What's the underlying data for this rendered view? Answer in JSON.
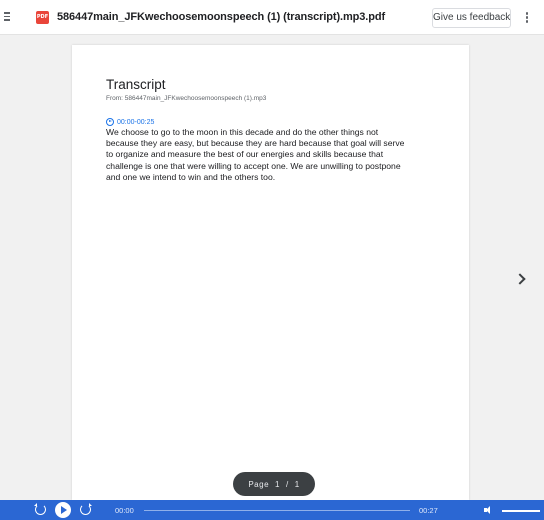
{
  "topbar": {
    "file_icon": "pdf-file-icon",
    "file_icon_label": "PDF",
    "file_name": "586447main_JFKwechoosemoonspeech (1) (transcript).mp3.pdf",
    "feedback_label": "Give us feedback"
  },
  "document": {
    "title": "Transcript",
    "from": "From: 586447main_JFKwechoosemoonspeech (1).mp3",
    "segments": [
      {
        "timestamp": "00:00-00:25",
        "text": "We choose to go to the moon in this decade and do the other things not because they are easy, but because they are hard because that goal will serve to organize and measure the best of our energies and skills because that challenge is one that were willing to accept one. We are unwilling to postpone and one we intend to win and the others too."
      }
    ]
  },
  "pagination": {
    "label": "Page",
    "current": "1",
    "separator": "/",
    "total": "1"
  },
  "audio": {
    "current_time": "00:00",
    "total_time": "00:27",
    "progress": 0,
    "volume": 1
  },
  "colors": {
    "accent": "#1a73e8",
    "audio_bar": "#2b67d3",
    "pdf_icon": "#e9453a"
  }
}
